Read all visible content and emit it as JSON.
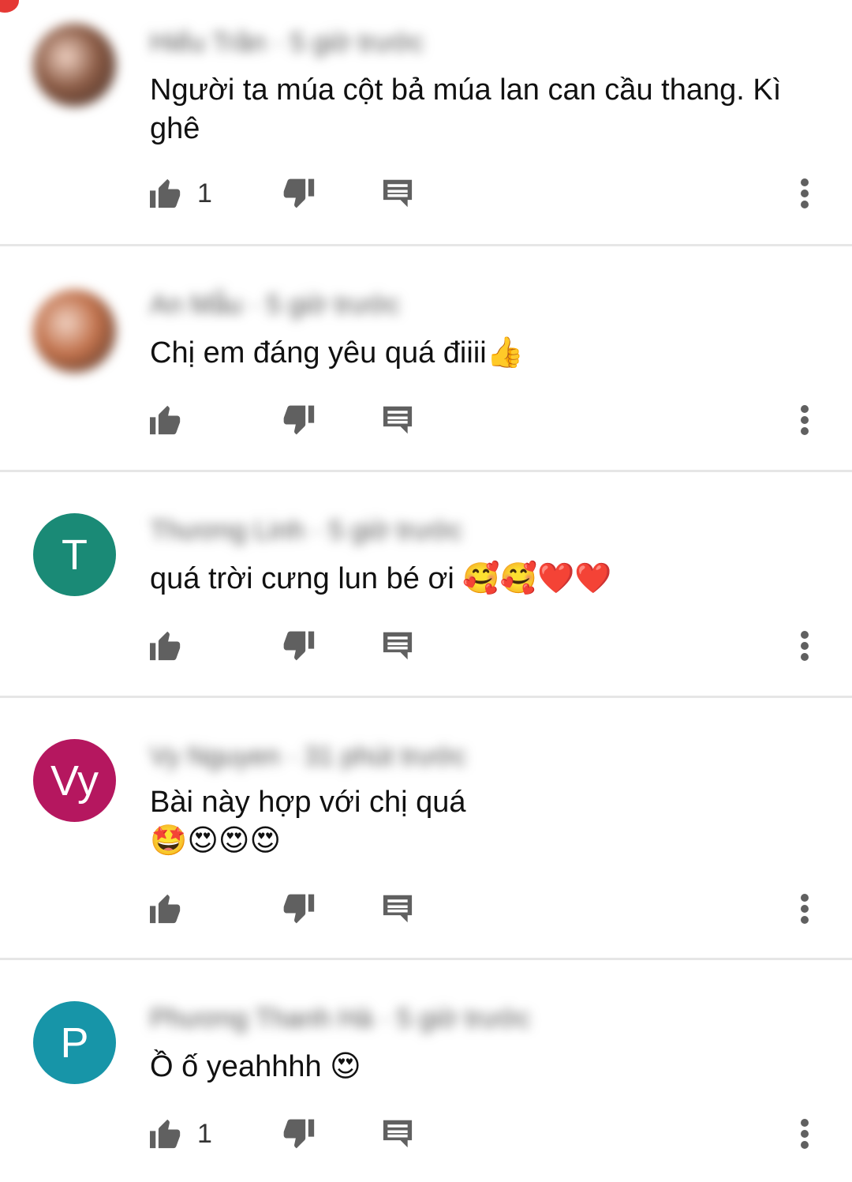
{
  "comments": [
    {
      "author": "Hiếu Trần · 5 giờ trước",
      "text": "Người ta múa cột bả múa lan can cầu thang. Kì ghê",
      "emoji": "",
      "likes": "1",
      "avatar": {
        "type": "photo",
        "letter": "",
        "color": "#8a5a44"
      }
    },
    {
      "author": "An Mẫu · 5 giờ trước",
      "text": "Chị em đáng yêu quá điiii",
      "emoji": "👍",
      "likes": "",
      "avatar": {
        "type": "photo",
        "letter": "",
        "color": "#c0704a"
      }
    },
    {
      "author": "Thương Linh · 5 giờ trước",
      "text": "quá trời cưng lun bé ơi ",
      "emoji": "🥰🥰❤️❤️",
      "likes": "",
      "avatar": {
        "type": "letter",
        "letter": "T",
        "color": "#1a8a76"
      }
    },
    {
      "author": "Vy Nguyen · 31 phút trước",
      "text": "Bài này hợp với chị quá ",
      "emoji": "🤩😍😍😍",
      "likes": "",
      "avatar": {
        "type": "letter",
        "letter": "Vy",
        "color": "#b5175f"
      }
    },
    {
      "author": "Phương Thanh Hà · 5 giờ trước",
      "text": "Ồ ố yeahhhh ",
      "emoji": "😍",
      "likes": "1",
      "avatar": {
        "type": "letter",
        "letter": "P",
        "color": "#1795a8"
      }
    }
  ],
  "icons": {
    "like": "thumb-up-icon",
    "dislike": "thumb-down-icon",
    "reply": "reply-icon",
    "more": "more-vert-icon"
  },
  "colors": {
    "icon": "#606060",
    "divider": "#e6e6e6",
    "notification_dot": "#e53935"
  }
}
